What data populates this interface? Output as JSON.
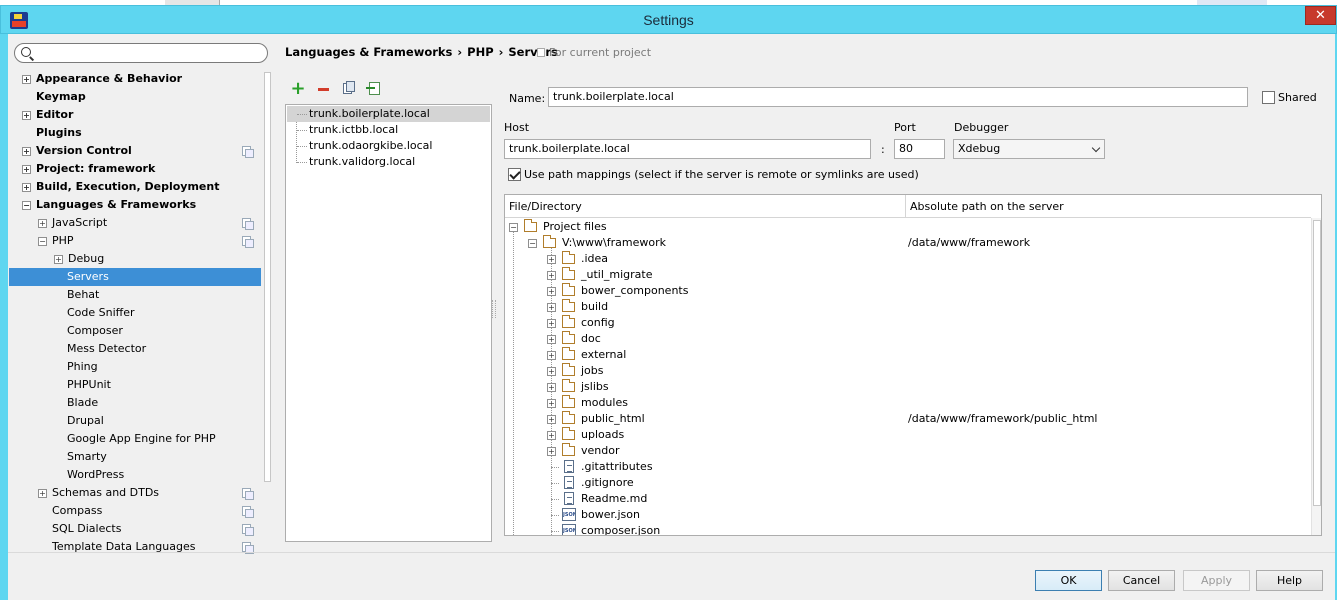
{
  "window": {
    "title": "Settings",
    "close_glyph": "✕"
  },
  "search": {
    "placeholder": "",
    "value": ""
  },
  "tree": [
    {
      "label": "Appearance & Behavior",
      "bold": true,
      "expander": "+",
      "level": 0
    },
    {
      "label": "Keymap",
      "bold": true,
      "expander": "",
      "level": 0
    },
    {
      "label": "Editor",
      "bold": true,
      "expander": "+",
      "level": 0
    },
    {
      "label": "Plugins",
      "bold": true,
      "expander": "",
      "level": 0
    },
    {
      "label": "Version Control",
      "bold": true,
      "expander": "+",
      "level": 0,
      "project_icon": true
    },
    {
      "label": "Project: framework",
      "bold": true,
      "expander": "+",
      "level": 0
    },
    {
      "label": "Build, Execution, Deployment",
      "bold": true,
      "expander": "+",
      "level": 0
    },
    {
      "label": "Languages & Frameworks",
      "bold": true,
      "expander": "−",
      "level": 0
    },
    {
      "label": "JavaScript",
      "bold": false,
      "expander": "+",
      "level": 1,
      "project_icon": true
    },
    {
      "label": "PHP",
      "bold": false,
      "expander": "−",
      "level": 1,
      "project_icon": true
    },
    {
      "label": "Debug",
      "bold": false,
      "expander": "+",
      "level": 2
    },
    {
      "label": "Servers",
      "bold": false,
      "expander": "",
      "level": 3,
      "selected": true
    },
    {
      "label": "Behat",
      "bold": false,
      "expander": "",
      "level": 3
    },
    {
      "label": "Code Sniffer",
      "bold": false,
      "expander": "",
      "level": 3
    },
    {
      "label": "Composer",
      "bold": false,
      "expander": "",
      "level": 3
    },
    {
      "label": "Mess Detector",
      "bold": false,
      "expander": "",
      "level": 3
    },
    {
      "label": "Phing",
      "bold": false,
      "expander": "",
      "level": 3
    },
    {
      "label": "PHPUnit",
      "bold": false,
      "expander": "",
      "level": 3
    },
    {
      "label": "Blade",
      "bold": false,
      "expander": "",
      "level": 3
    },
    {
      "label": "Drupal",
      "bold": false,
      "expander": "",
      "level": 3
    },
    {
      "label": "Google App Engine for PHP",
      "bold": false,
      "expander": "",
      "level": 3
    },
    {
      "label": "Smarty",
      "bold": false,
      "expander": "",
      "level": 3
    },
    {
      "label": "WordPress",
      "bold": false,
      "expander": "",
      "level": 3
    },
    {
      "label": "Schemas and DTDs",
      "bold": false,
      "expander": "+",
      "level": 1,
      "project_icon": true
    },
    {
      "label": "Compass",
      "bold": false,
      "expander": "",
      "level": 1,
      "project_icon": true
    },
    {
      "label": "SQL Dialects",
      "bold": false,
      "expander": "",
      "level": 1,
      "project_icon": true
    },
    {
      "label": "Template Data Languages",
      "bold": false,
      "expander": "",
      "level": 1,
      "project_icon": true
    }
  ],
  "breadcrumb": {
    "items": [
      "Languages & Frameworks",
      "PHP",
      "Servers"
    ],
    "separator": "›",
    "scope": "For current project"
  },
  "servers": [
    "trunk.boilerplate.local",
    "trunk.ictbb.local",
    "trunk.odaorgkibe.local",
    "trunk.validorg.local"
  ],
  "form": {
    "name_label": "Name:",
    "name_value": "trunk.boilerplate.local",
    "shared_label": "Shared",
    "host_label": "Host",
    "host_value": "trunk.boilerplate.local",
    "colon": ":",
    "port_label": "Port",
    "port_value": "80",
    "debugger_label": "Debugger",
    "debugger_value": "Xdebug",
    "use_path_mappings_label": "Use path mappings (select if the server is remote or symlinks are used)"
  },
  "mapping_table": {
    "col1": "File/Directory",
    "col2": "Absolute path on the server",
    "rows": [
      {
        "name": "Project files",
        "kind": "folder",
        "depth": 0,
        "expander": "−",
        "server_path": ""
      },
      {
        "name": "V:\\www\\framework",
        "kind": "folder",
        "depth": 1,
        "expander": "−",
        "server_path": "/data/www/framework"
      },
      {
        "name": ".idea",
        "kind": "folder",
        "depth": 2,
        "expander": "+",
        "server_path": ""
      },
      {
        "name": "_util_migrate",
        "kind": "folder",
        "depth": 2,
        "expander": "+",
        "server_path": ""
      },
      {
        "name": "bower_components",
        "kind": "folder",
        "depth": 2,
        "expander": "+",
        "server_path": ""
      },
      {
        "name": "build",
        "kind": "folder",
        "depth": 2,
        "expander": "+",
        "server_path": ""
      },
      {
        "name": "config",
        "kind": "folder",
        "depth": 2,
        "expander": "+",
        "server_path": ""
      },
      {
        "name": "doc",
        "kind": "folder",
        "depth": 2,
        "expander": "+",
        "server_path": ""
      },
      {
        "name": "external",
        "kind": "folder",
        "depth": 2,
        "expander": "+",
        "server_path": ""
      },
      {
        "name": "jobs",
        "kind": "folder",
        "depth": 2,
        "expander": "+",
        "server_path": ""
      },
      {
        "name": "jslibs",
        "kind": "folder",
        "depth": 2,
        "expander": "+",
        "server_path": ""
      },
      {
        "name": "modules",
        "kind": "folder",
        "depth": 2,
        "expander": "+",
        "server_path": ""
      },
      {
        "name": "public_html",
        "kind": "folder",
        "depth": 2,
        "expander": "+",
        "server_path": "/data/www/framework/public_html"
      },
      {
        "name": "uploads",
        "kind": "folder",
        "depth": 2,
        "expander": "+",
        "server_path": ""
      },
      {
        "name": "vendor",
        "kind": "folder",
        "depth": 2,
        "expander": "+",
        "server_path": ""
      },
      {
        "name": ".gitattributes",
        "kind": "file",
        "depth": 2,
        "expander": "",
        "server_path": ""
      },
      {
        "name": ".gitignore",
        "kind": "file",
        "depth": 2,
        "expander": "",
        "server_path": ""
      },
      {
        "name": "Readme.md",
        "kind": "file",
        "depth": 2,
        "expander": "",
        "server_path": ""
      },
      {
        "name": "bower.json",
        "kind": "json",
        "depth": 2,
        "expander": "",
        "server_path": ""
      },
      {
        "name": "composer.json",
        "kind": "json",
        "depth": 2,
        "expander": "",
        "server_path": ""
      }
    ]
  },
  "buttons": {
    "ok": "OK",
    "cancel": "Cancel",
    "apply": "Apply",
    "help": "Help"
  },
  "icons": {
    "add": "add-icon",
    "remove": "remove-icon",
    "copy": "copy-icon",
    "import": "import-icon",
    "json_badge": "JSON"
  },
  "colors": {
    "titlebar": "#5ed6f0",
    "selection": "#3d8fd6",
    "close": "#c7392c"
  }
}
